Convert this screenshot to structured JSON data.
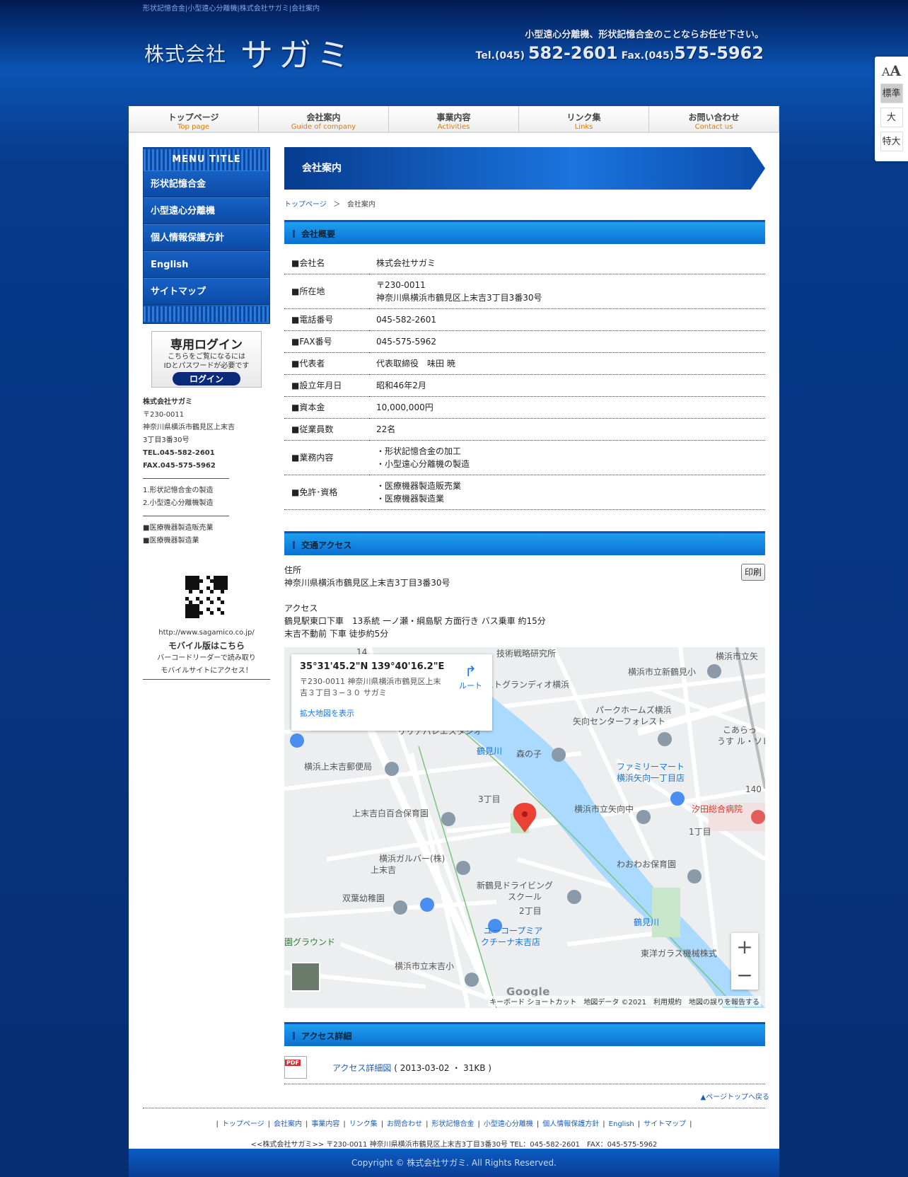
{
  "header": {
    "tagline": "形状記憶合金|小型遠心分離機|株式会社サガミ|会社案内",
    "logo_small": "株式会社",
    "logo_big": "サガミ",
    "slogan": "小型遠心分離機、形状記憶合金のことならお任せ下さい。",
    "tel_label": "Tel.(045)",
    "tel_num": "582-2601",
    "fax_label": "Fax.(045)",
    "fax_num": "575-5962"
  },
  "font_switcher": {
    "icon": "font-size-icon",
    "standard": "標準",
    "large": "大",
    "xlarge": "特大"
  },
  "global_nav": [
    {
      "ja": "トップページ",
      "en": "Top page"
    },
    {
      "ja": "会社案内",
      "en": "Guide of company"
    },
    {
      "ja": "事業内容",
      "en": "Activities"
    },
    {
      "ja": "リンク集",
      "en": "Links"
    },
    {
      "ja": "お問い合わせ",
      "en": "Contact us"
    }
  ],
  "sidebar": {
    "menu_title": "MENU TITLE",
    "items": [
      "形状記憶合金",
      "小型遠心分離機",
      "個人情報保護方針",
      "English",
      "サイトマップ"
    ],
    "login": {
      "title": "専用ログイン",
      "desc1": "こちらをご覧になるには",
      "desc2": "IDとパスワードが必要です",
      "button": "ログイン"
    },
    "company": "株式会社サガミ",
    "zip": "〒230-0011",
    "addr1": "神奈川県横浜市鶴見区上末吉",
    "addr2": "3丁目3番30号",
    "tel": "TEL.045-582-2601",
    "fax": "FAX.045-575-5962",
    "biz1": "1.形状記憶合金の製造",
    "biz2": "2.小型遠心分離機製造",
    "lic1": "■医療機器製造販売業",
    "lic2": "■医療機器製造業",
    "mobile_url": "http://www.sagamico.co.jp/",
    "mobile_title": "モバイル版はこちら",
    "mobile_desc1": "バーコードリーダーで読み取り",
    "mobile_desc2": "モバイルサイトにアクセス！"
  },
  "main": {
    "page_title": "会社案内",
    "breadcrumb": {
      "home": "トップページ",
      "sep": "＞",
      "current": "会社案内"
    },
    "overview_title": "会社概要",
    "overview": [
      {
        "k": "■会社名",
        "v": [
          "株式会社サガミ"
        ]
      },
      {
        "k": "■所在地",
        "v": [
          "〒230-0011",
          "神奈川県横浜市鶴見区上末吉3丁目3番30号"
        ]
      },
      {
        "k": "■電話番号",
        "v": [
          "045-582-2601"
        ]
      },
      {
        "k": "■FAX番号",
        "v": [
          "045-575-5962"
        ]
      },
      {
        "k": "■代表者",
        "v": [
          "代表取締役　味田 暁"
        ]
      },
      {
        "k": "■設立年月日",
        "v": [
          "昭和46年2月"
        ]
      },
      {
        "k": "■資本金",
        "v": [
          "10,000,000円"
        ]
      },
      {
        "k": "■従業員数",
        "v": [
          "22名"
        ]
      },
      {
        "k": "■業務内容",
        "v": [
          "・形状記憶合金の加工",
          "・小型遠心分離機の製造"
        ]
      },
      {
        "k": "■免許･資格",
        "v": [
          "・医療機器製造販売業",
          "・医療機器製造業"
        ]
      }
    ],
    "access_title": "交通アクセス",
    "access": {
      "addr_label": "住所",
      "addr": "神奈川県横浜市鶴見区上末吉3丁目3番30号",
      "print": "印刷",
      "access_label": "アクセス",
      "line1": "鶴見駅東口下車　13系統 一ノ瀬・綱島駅 方面行き バス乗車 約15分",
      "line2": "末吉不動前 下車 徒歩約5分"
    },
    "map": {
      "popup_title": "35°31'45.2\"N 139°40'16.2\"E",
      "popup_addr": "〒230-0011 神奈川県横浜市鶴見区上末吉３丁目３−３０ サガミ",
      "popup_link": "拡大地図を表示",
      "route": "ルート",
      "labels": {
        "l1": "技術戦略研究所",
        "l2": "横浜市立矢",
        "l3": "横浜市立新鶴見小",
        "l4": "レストグランディオ横浜",
        "l5": "パークホームズ横浜",
        "l6": "矢向センターフォレスト",
        "l7": "こあらっ",
        "l8": "うす ル・ソレ",
        "l9": "リリアパレエスタジオ",
        "l10": "鶴見川",
        "l11": "森の子",
        "l12": "横浜上末吉郵便局",
        "l13": "ファミリーマート",
        "l14": "横浜矢向一丁目店",
        "l15": "3丁目",
        "l16": "上末吉白百合保育園",
        "l17": "横浜市立矢向中",
        "l18": "汐田総合病院",
        "l19": "1丁目",
        "l20": "横浜ガルバー(株)",
        "l21": "上末吉",
        "l22": "わおわお保育園",
        "l23": "新鶴見ドライビング",
        "l24": "スクール",
        "l25": "双葉幼稚園",
        "l26": "2丁目",
        "l27": "鶴見川",
        "l28": "ユーコープミア",
        "l29": "クチーナ末吉店",
        "l30": "園グラウンド",
        "l31": "東洋ガラス機械株式",
        "l32": "横浜市立末吉小",
        "l33": "14",
        "l34": "140"
      },
      "google": "Google",
      "footer": "キーボード ショートカット　地図データ ©2021　利用規約　地図の誤りを報告する"
    },
    "detail_title": "アクセス詳細",
    "detail_pdf_icon": "PDF",
    "detail_link": "アクセス詳細図",
    "detail_meta": "( 2013-03-02 ・ 31KB )"
  },
  "footer": {
    "pagetop": "▲ページトップへ戻る",
    "nav": [
      "トップページ",
      "会社案内",
      "事業内容",
      "リンク集",
      "お問合わせ",
      "形状記憶合金",
      "小型遠心分離機",
      "個人情報保護方針",
      "English",
      "サイトマップ"
    ],
    "address": "<<株式会社サガミ>> 〒230-0011 神奈川県横浜市鶴見区上末吉3丁目3番30号 TEL：045-582-2601　FAX：045-575-5962",
    "copyright": "Copyright © 株式会社サガミ. All Rights Reserved."
  }
}
